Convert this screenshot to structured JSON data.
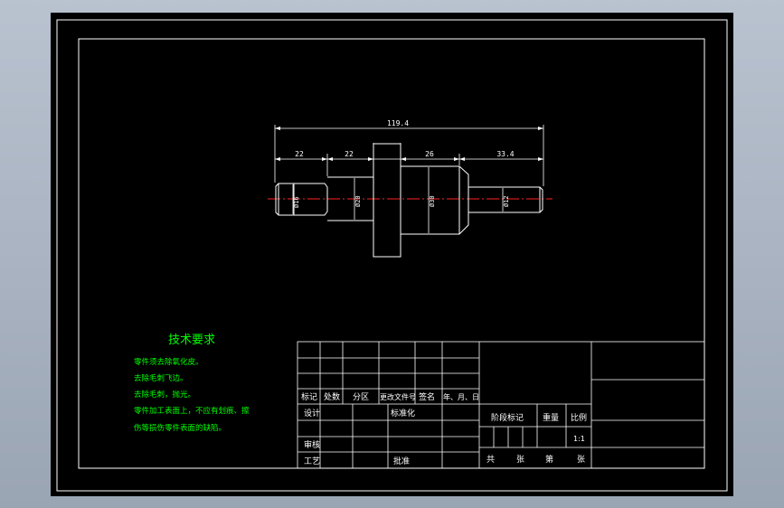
{
  "dimensions": {
    "overall": "119.4",
    "seg1": "22",
    "seg2": "22",
    "seg3": "26",
    "seg4": "33.4",
    "dia1": "Ø16",
    "dia2": "Ø20",
    "dia3": "Ø30",
    "dia4": "Ø12"
  },
  "tech": {
    "title": "技术要求",
    "lines": [
      "零件须去除氧化皮。",
      "去除毛刺飞边。",
      "去除毛刺，抛光。",
      "零件加工表面上，不应有划痕、擦",
      "伤等损伤零件表面的缺陷。"
    ]
  },
  "titleblock": {
    "biaoji": "标记",
    "chushu": "处数",
    "fenqu": "分区",
    "gengai": "更改文件号",
    "qianming": "签名",
    "date": "年、月、日",
    "sheji": "设计",
    "biaozhunhua": "标准化",
    "jieduan": "阶段标记",
    "zhongliang": "重量",
    "bili": "比例",
    "scale": "1:1",
    "shenhe": "审核",
    "gongyi": "工艺",
    "pizhun": "批准",
    "gong": "共",
    "zhang1": "张",
    "di": "第",
    "zhang2": "张"
  }
}
